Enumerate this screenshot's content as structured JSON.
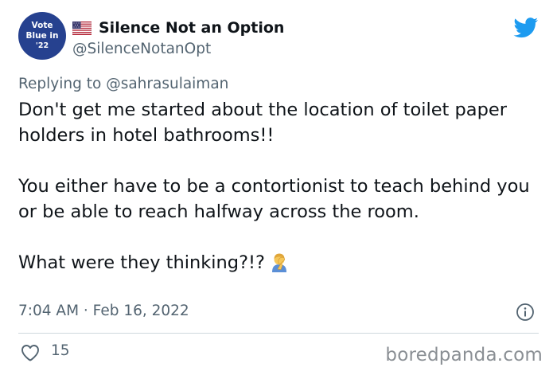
{
  "avatar": {
    "line1": "Vote",
    "line2": "Blue in",
    "line3": "'22"
  },
  "author": {
    "display_name": "Silence Not an Option",
    "handle": "@SilenceNotanOpt",
    "flag_icon": "us-flag-icon"
  },
  "reply": {
    "prefix": "Replying to ",
    "mention": "@sahrasulaiman"
  },
  "tweet": {
    "paragraph1": "Don't get me started about the location of toilet paper holders in hotel bathrooms!!",
    "paragraph2": "You either have to be a contortionist to teach behind you or be able to reach halfway across the room.",
    "paragraph3": "What were they thinking?!?",
    "emoji_icon": "facepalm-icon",
    "timestamp": "7:04 AM · Feb 16, 2022"
  },
  "actions": {
    "like_icon": "heart-icon",
    "like_count": "15",
    "info_icon": "info-icon"
  },
  "watermark": "boredpanda.com",
  "colors": {
    "brand_twitter": "#1d9bf0",
    "avatar_bg": "#26418f",
    "text_primary": "#0f1419",
    "text_secondary": "#536471"
  }
}
